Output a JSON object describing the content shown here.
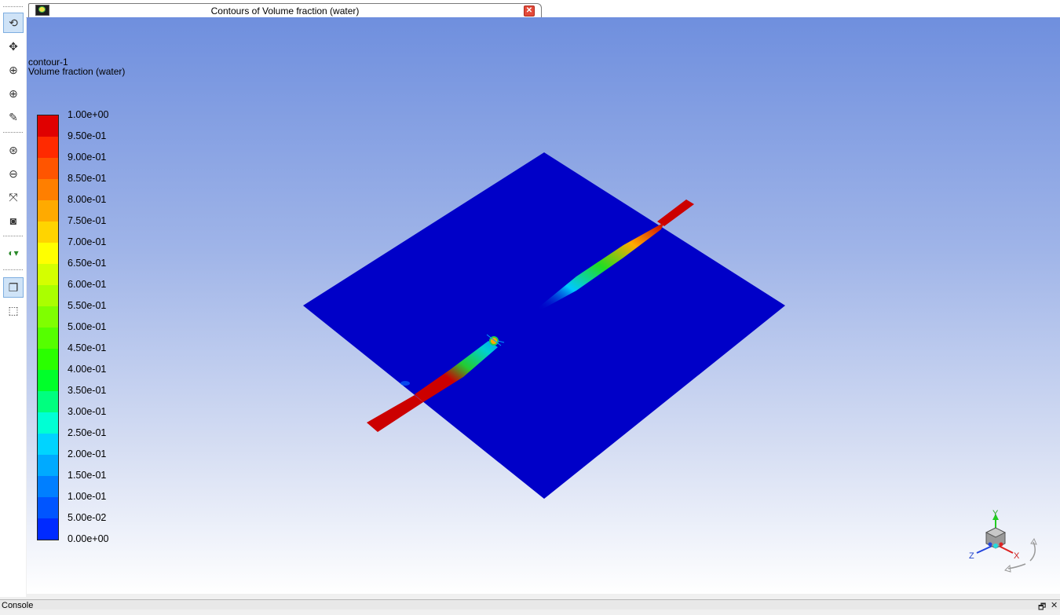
{
  "window": {
    "tab_title": "Contours of Volume fraction (water)",
    "close_glyph": "✕"
  },
  "toolbar": {
    "tools": [
      {
        "name": "rotate-tool",
        "icon": "rotate-icon",
        "glyph": "⟲",
        "active": true
      },
      {
        "name": "pan-tool",
        "icon": "pan-icon",
        "glyph": "✥",
        "active": false
      },
      {
        "name": "zoom-tool",
        "icon": "zoom-icon",
        "glyph": "⊕",
        "active": false
      },
      {
        "name": "zoom-box-tool",
        "icon": "zoom-box-icon",
        "glyph": "⊕",
        "active": false
      },
      {
        "name": "probe-tool",
        "icon": "probe-icon",
        "glyph": "✎",
        "active": false
      },
      {
        "name": "fit-window-tool",
        "icon": "fit-window-icon",
        "glyph": "⊛",
        "active": false
      },
      {
        "name": "zoom-out-tool",
        "icon": "zoom-out-icon",
        "glyph": "⊖",
        "active": false
      },
      {
        "name": "isometric-view-tool",
        "icon": "isometric-view-icon",
        "glyph": "⤧",
        "active": false
      },
      {
        "name": "snapshot-tool",
        "icon": "camera-icon",
        "glyph": "◙",
        "active": false
      },
      {
        "name": "view-options-tool",
        "icon": "view-options-icon",
        "glyph": "◐▾",
        "active": false
      },
      {
        "name": "perspective-view-tool",
        "icon": "perspective-icon",
        "glyph": "❐",
        "active": true
      },
      {
        "name": "orthographic-view-tool",
        "icon": "orthographic-icon",
        "glyph": "⬚",
        "active": false
      }
    ]
  },
  "plot": {
    "name": "contour-1",
    "variable": "Volume fraction (water)"
  },
  "colorbar": {
    "labels": [
      "1.00e+00",
      "9.50e-01",
      "9.00e-01",
      "8.50e-01",
      "8.00e-01",
      "7.50e-01",
      "7.00e-01",
      "6.50e-01",
      "6.00e-01",
      "5.50e-01",
      "5.00e-01",
      "4.50e-01",
      "4.00e-01",
      "3.50e-01",
      "3.00e-01",
      "2.50e-01",
      "2.00e-01",
      "1.50e-01",
      "1.00e-01",
      "5.00e-02",
      "0.00e+00"
    ],
    "colors": [
      "#e00000",
      "#ff2a00",
      "#ff5500",
      "#ff7f00",
      "#ffaa00",
      "#ffd400",
      "#ffff00",
      "#d4ff00",
      "#aaff00",
      "#7fff00",
      "#55ff00",
      "#2aff00",
      "#00ff2a",
      "#00ff7f",
      "#00ffd4",
      "#00d4ff",
      "#00aaff",
      "#007fff",
      "#0055ff",
      "#002aff",
      "#0000d4"
    ]
  },
  "scene": {
    "plate_color": "#0000c8",
    "strip_color": "#cc0000"
  },
  "triad": {
    "x": "X",
    "y": "Y",
    "z": "Z"
  },
  "console": {
    "title": "Console",
    "restore_glyph": "🗗",
    "close_glyph": "✕"
  }
}
